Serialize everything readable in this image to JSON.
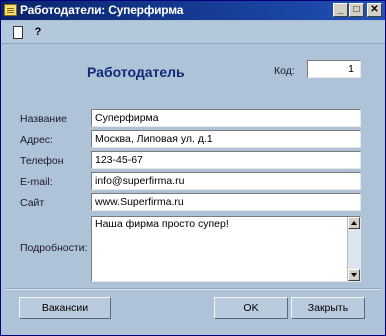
{
  "window": {
    "title": "Работодатели: Суперфирма",
    "minimize_glyph": "_",
    "maximize_glyph": "□",
    "close_glyph": "✕"
  },
  "toolbar": {
    "icons": [
      "document-icon",
      "help-cursor-icon"
    ],
    "document_glyph": "▯",
    "help_glyph": "?"
  },
  "form": {
    "heading": "Работодатель",
    "code_label": "Код:",
    "code_value": "1",
    "fields": {
      "name": {
        "label": "Название",
        "value": "Суперфирма"
      },
      "address": {
        "label": "Адрес:",
        "value": "Москва, Липовая ул. д.1"
      },
      "phone": {
        "label": "Телефон",
        "value": "123-45-67"
      },
      "email": {
        "label": "E-mail:",
        "value": "info@superfirma.ru"
      },
      "site": {
        "label": "Сайт",
        "value": "www.Superfirma.ru"
      },
      "details": {
        "label": "Подробности:",
        "value": "Наша фирма просто супер!"
      }
    }
  },
  "buttons": {
    "vacancies": "Вакансии",
    "ok": "OK",
    "close": "Закрыть"
  }
}
